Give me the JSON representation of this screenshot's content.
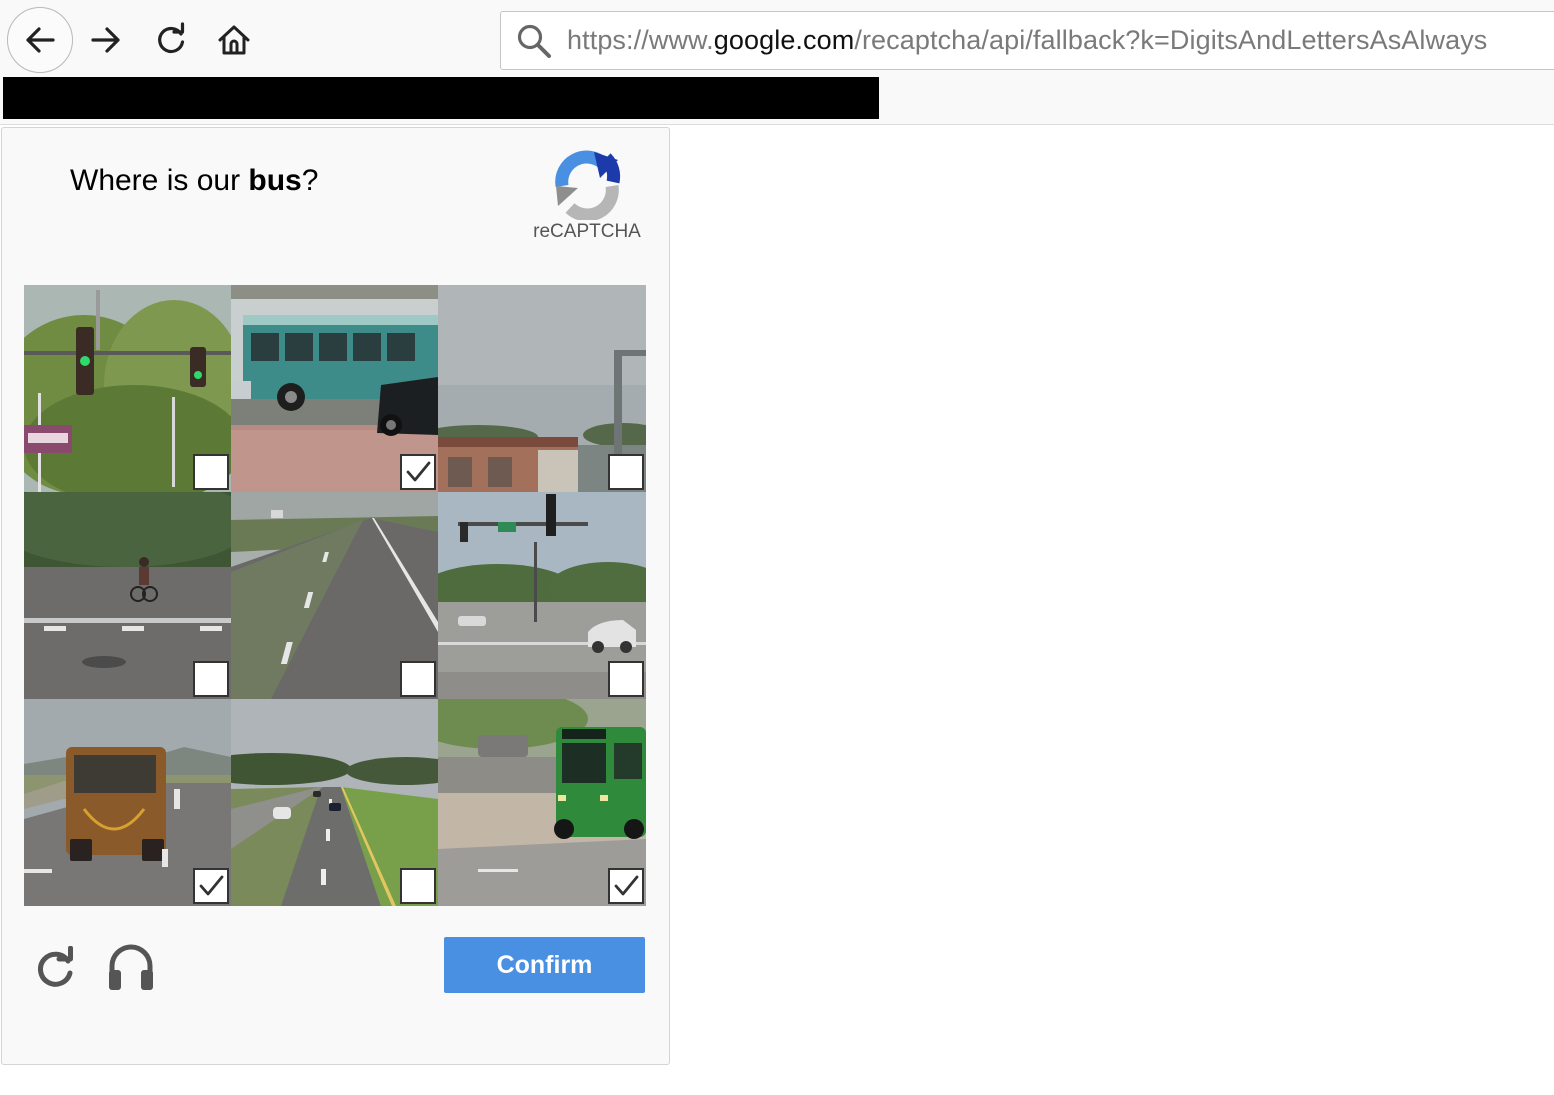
{
  "browser": {
    "url": {
      "prefix": "https://www.",
      "domain": "google.com",
      "path": "/recaptcha/api/fallback?k=DigitsAndLettersAsAlways"
    }
  },
  "captcha": {
    "prompt_before": "Where is our ",
    "prompt_keyword": "bus",
    "prompt_after": "?",
    "brand_label": "reCAPTCHA",
    "confirm_label": "Confirm",
    "tiles": [
      {
        "scene": "traffic-lights-trees",
        "checked": false
      },
      {
        "scene": "green-bus",
        "checked": true
      },
      {
        "scene": "building-under-sky",
        "checked": false
      },
      {
        "scene": "cyclist-road",
        "checked": false
      },
      {
        "scene": "highway-lanes",
        "checked": false
      },
      {
        "scene": "intersection-cars",
        "checked": false
      },
      {
        "scene": "coach-bus-highway",
        "checked": true
      },
      {
        "scene": "divided-highway",
        "checked": false
      },
      {
        "scene": "green-bus-turning",
        "checked": true
      }
    ]
  }
}
